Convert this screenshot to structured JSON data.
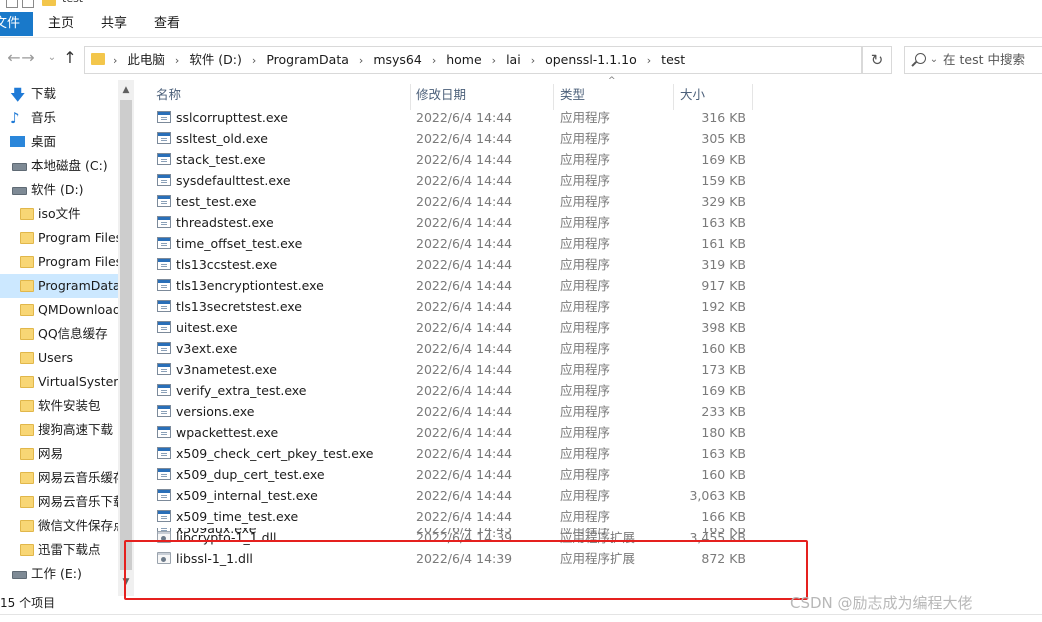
{
  "window": {
    "title_text": "test"
  },
  "ribbon": {
    "tabs": [
      "文件",
      "主页",
      "共享",
      "查看"
    ]
  },
  "address": {
    "breadcrumbs": [
      "此电脑",
      "软件 (D:)",
      "ProgramData",
      "msys64",
      "home",
      "lai",
      "openssl-1.1.1o",
      "test"
    ],
    "search_placeholder": "在 test 中搜索"
  },
  "nav": {
    "back": "←",
    "forward": "→",
    "up": "↑",
    "recent": "⌄",
    "refresh": "↻",
    "dropdown": "⌄"
  },
  "sidebar": {
    "items": [
      {
        "label": "下载",
        "icon": "download-icon"
      },
      {
        "label": "音乐",
        "icon": "music-icon"
      },
      {
        "label": "桌面",
        "icon": "desktop-icon"
      },
      {
        "label": "本地磁盘 (C:)",
        "icon": "drive-icon"
      },
      {
        "label": "软件 (D:)",
        "icon": "drive-icon"
      },
      {
        "label": "iso文件",
        "icon": "folder-icon"
      },
      {
        "label": "Program Files",
        "icon": "folder-icon"
      },
      {
        "label": "Program Files",
        "icon": "folder-icon"
      },
      {
        "label": "ProgramData",
        "icon": "folder-icon",
        "selected": true
      },
      {
        "label": "QMDownload",
        "icon": "folder-icon"
      },
      {
        "label": "QQ信息缓存",
        "icon": "folder-icon"
      },
      {
        "label": "Users",
        "icon": "folder-icon"
      },
      {
        "label": "VirtualSystem",
        "icon": "folder-icon"
      },
      {
        "label": "软件安装包",
        "icon": "folder-icon"
      },
      {
        "label": "搜狗高速下载",
        "icon": "folder-icon"
      },
      {
        "label": "网易",
        "icon": "folder-icon"
      },
      {
        "label": "网易云音乐缓存",
        "icon": "folder-icon"
      },
      {
        "label": "网易云音乐下载",
        "icon": "folder-icon"
      },
      {
        "label": "微信文件保存点",
        "icon": "folder-icon"
      },
      {
        "label": "迅雷下载点",
        "icon": "folder-icon"
      },
      {
        "label": "工作 (E:)",
        "icon": "drive-icon"
      }
    ]
  },
  "columns": {
    "name": "名称",
    "date": "修改日期",
    "type": "类型",
    "size": "大小"
  },
  "files": [
    {
      "name": "sslcorrupttest.exe",
      "date": "2022/6/4 14:44",
      "type": "应用程序",
      "size": "316 KB",
      "kind": "exe"
    },
    {
      "name": "ssltest_old.exe",
      "date": "2022/6/4 14:44",
      "type": "应用程序",
      "size": "305 KB",
      "kind": "exe"
    },
    {
      "name": "stack_test.exe",
      "date": "2022/6/4 14:44",
      "type": "应用程序",
      "size": "169 KB",
      "kind": "exe"
    },
    {
      "name": "sysdefaulttest.exe",
      "date": "2022/6/4 14:44",
      "type": "应用程序",
      "size": "159 KB",
      "kind": "exe"
    },
    {
      "name": "test_test.exe",
      "date": "2022/6/4 14:44",
      "type": "应用程序",
      "size": "329 KB",
      "kind": "exe"
    },
    {
      "name": "threadstest.exe",
      "date": "2022/6/4 14:44",
      "type": "应用程序",
      "size": "163 KB",
      "kind": "exe"
    },
    {
      "name": "time_offset_test.exe",
      "date": "2022/6/4 14:44",
      "type": "应用程序",
      "size": "161 KB",
      "kind": "exe"
    },
    {
      "name": "tls13ccstest.exe",
      "date": "2022/6/4 14:44",
      "type": "应用程序",
      "size": "319 KB",
      "kind": "exe"
    },
    {
      "name": "tls13encryptiontest.exe",
      "date": "2022/6/4 14:44",
      "type": "应用程序",
      "size": "917 KB",
      "kind": "exe"
    },
    {
      "name": "tls13secretstest.exe",
      "date": "2022/6/4 14:44",
      "type": "应用程序",
      "size": "192 KB",
      "kind": "exe"
    },
    {
      "name": "uitest.exe",
      "date": "2022/6/4 14:44",
      "type": "应用程序",
      "size": "398 KB",
      "kind": "exe"
    },
    {
      "name": "v3ext.exe",
      "date": "2022/6/4 14:44",
      "type": "应用程序",
      "size": "160 KB",
      "kind": "exe"
    },
    {
      "name": "v3nametest.exe",
      "date": "2022/6/4 14:44",
      "type": "应用程序",
      "size": "173 KB",
      "kind": "exe"
    },
    {
      "name": "verify_extra_test.exe",
      "date": "2022/6/4 14:44",
      "type": "应用程序",
      "size": "169 KB",
      "kind": "exe"
    },
    {
      "name": "versions.exe",
      "date": "2022/6/4 14:44",
      "type": "应用程序",
      "size": "233 KB",
      "kind": "exe"
    },
    {
      "name": "wpackettest.exe",
      "date": "2022/6/4 14:44",
      "type": "应用程序",
      "size": "180 KB",
      "kind": "exe"
    },
    {
      "name": "x509_check_cert_pkey_test.exe",
      "date": "2022/6/4 14:44",
      "type": "应用程序",
      "size": "163 KB",
      "kind": "exe"
    },
    {
      "name": "x509_dup_cert_test.exe",
      "date": "2022/6/4 14:44",
      "type": "应用程序",
      "size": "160 KB",
      "kind": "exe"
    },
    {
      "name": "x509_internal_test.exe",
      "date": "2022/6/4 14:44",
      "type": "应用程序",
      "size": "3,063 KB",
      "kind": "exe"
    },
    {
      "name": "x509_time_test.exe",
      "date": "2022/6/4 14:44",
      "type": "应用程序",
      "size": "166 KB",
      "kind": "exe"
    },
    {
      "name": "x509aux.exe",
      "date": "2022/6/4 14:45",
      "type": "应用程序",
      "size": "163 KB",
      "kind": "exe",
      "partial": true
    },
    {
      "name": "libcrypto-1_1.dll",
      "date": "2022/6/4 14:39",
      "type": "应用程序扩展",
      "size": "3,455 KB",
      "kind": "dll"
    },
    {
      "name": "libssl-1_1.dll",
      "date": "2022/6/4 14:39",
      "type": "应用程序扩展",
      "size": "872 KB",
      "kind": "dll"
    }
  ],
  "status": {
    "count_text": "15 个项目"
  },
  "watermark": "CSDN @励志成为编程大佬",
  "colors": {
    "accent": "#1979ca",
    "selected_bg": "#cce8ff",
    "highlight_box": "#e5201e"
  }
}
